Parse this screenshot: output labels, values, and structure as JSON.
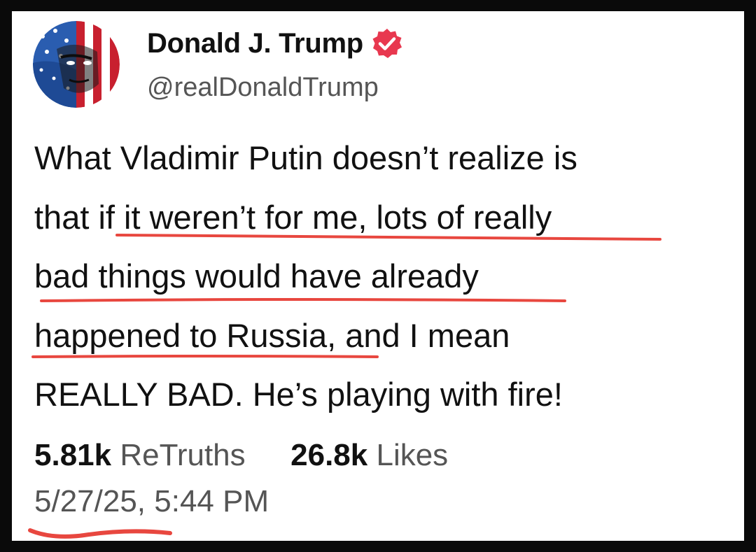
{
  "author": {
    "display_name": "Donald J. Trump",
    "handle": "@realDonaldTrump",
    "avatar_icon": "avatar-flag-portrait",
    "verified_icon": "verified-badge-icon",
    "verified_color": "#e8384f"
  },
  "post": {
    "lines": [
      "What Vladimir Putin doesn’t realize is",
      "that if it weren’t for me, lots of really",
      "bad things would have already",
      "happened to Russia, and I mean",
      "REALLY BAD. He’s playing with fire!"
    ]
  },
  "stats": {
    "retruths_count": "5.81k",
    "retruths_label": "ReTruths",
    "likes_count": "26.8k",
    "likes_label": "Likes"
  },
  "timestamp": "5/27/25, 5:44 PM",
  "colors": {
    "background": "#ffffff",
    "frame": "#0a0a0a",
    "text": "#111111",
    "muted": "#555555",
    "annotation": "#e8473f"
  }
}
